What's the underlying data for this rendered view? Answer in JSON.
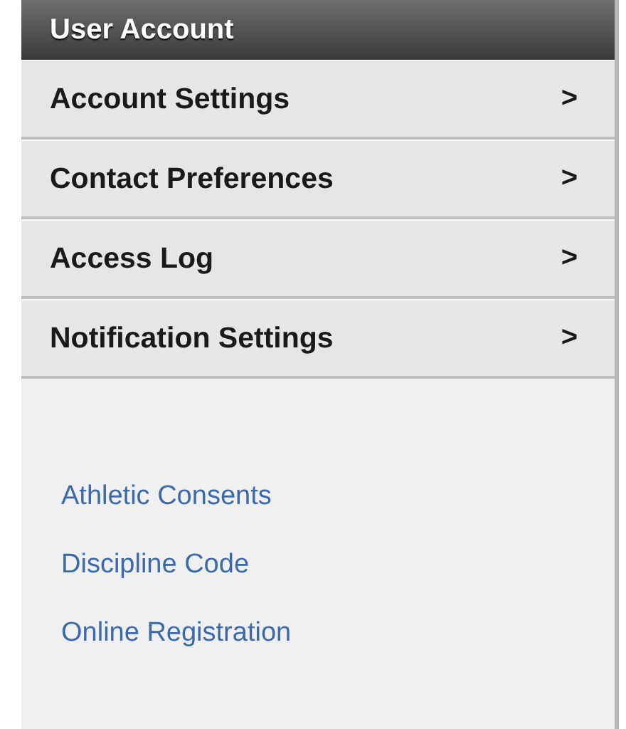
{
  "header": {
    "title": "User Account"
  },
  "menu": [
    {
      "label": "Account Settings",
      "arrow": ">"
    },
    {
      "label": "Contact Preferences",
      "arrow": ">"
    },
    {
      "label": "Access Log",
      "arrow": ">"
    },
    {
      "label": "Notification Settings",
      "arrow": ">"
    }
  ],
  "links": [
    "Athletic Consents",
    "Discipline Code",
    "Online Registration"
  ]
}
